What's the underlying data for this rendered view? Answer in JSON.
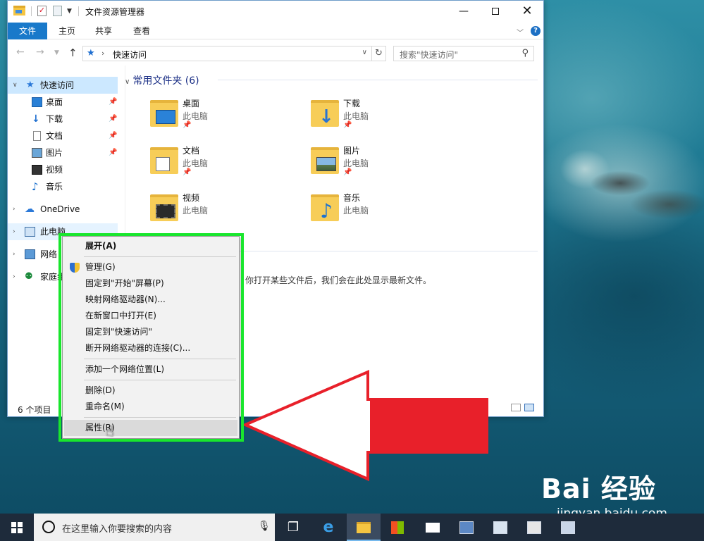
{
  "window": {
    "title": "文件资源管理器",
    "ribbon_tabs": [
      "文件",
      "主页",
      "共享",
      "查看"
    ],
    "help_label": "?",
    "address": "快速访问",
    "search_placeholder": "搜索\"快速访问\"",
    "status": "6 个项目"
  },
  "nav_pane": {
    "items": [
      {
        "label": "快速访问",
        "icon": "star-icon",
        "pinned": false
      },
      {
        "label": "桌面",
        "icon": "desktop-icon",
        "pinned": true
      },
      {
        "label": "下载",
        "icon": "download-icon",
        "pinned": true
      },
      {
        "label": "文档",
        "icon": "document-icon",
        "pinned": true
      },
      {
        "label": "图片",
        "icon": "picture-icon",
        "pinned": true
      },
      {
        "label": "视频",
        "icon": "video-icon",
        "pinned": false
      },
      {
        "label": "音乐",
        "icon": "music-icon",
        "pinned": false
      },
      {
        "label": "OneDrive",
        "icon": "cloud-icon",
        "pinned": false
      },
      {
        "label": "此电脑",
        "icon": "computer-icon",
        "pinned": false
      },
      {
        "label": "网络",
        "icon": "network-icon",
        "pinned": false
      },
      {
        "label": "家庭组",
        "icon": "homegroup-icon",
        "pinned": false
      }
    ]
  },
  "content": {
    "group_header": "常用文件夹 (6)",
    "folders": [
      {
        "name": "桌面",
        "location": "此电脑"
      },
      {
        "name": "下载",
        "location": "此电脑"
      },
      {
        "name": "文档",
        "location": "此电脑"
      },
      {
        "name": "图片",
        "location": "此电脑"
      },
      {
        "name": "视频",
        "location": "此电脑"
      },
      {
        "name": "音乐",
        "location": "此电脑"
      }
    ],
    "recent_hint": "你打开某些文件后，我们会在此处显示最新文件。"
  },
  "context_menu": {
    "items": [
      {
        "label": "展开(A)",
        "bold": true
      },
      {
        "label": "管理(G)",
        "icon": "shield-icon"
      },
      {
        "label": "固定到\"开始\"屏幕(P)"
      },
      {
        "label": "映射网络驱动器(N)..."
      },
      {
        "label": "在新窗口中打开(E)"
      },
      {
        "label": "固定到\"快速访问\""
      },
      {
        "label": "断开网络驱动器的连接(C)..."
      },
      {
        "label": "添加一个网络位置(L)"
      },
      {
        "label": "删除(D)"
      },
      {
        "label": "重命名(M)"
      },
      {
        "label": "属性(R)",
        "hovered": true
      }
    ]
  },
  "taskbar": {
    "search_placeholder": "在这里输入你要搜索的内容"
  },
  "watermark": {
    "logo": "Bai 经验",
    "url": "jingyan.baidu.com"
  },
  "colors": {
    "highlight_box": "#19e62d",
    "arrow": "#e8202a",
    "file_tab": "#1979ca",
    "taskbar": "#1e2b3b"
  }
}
